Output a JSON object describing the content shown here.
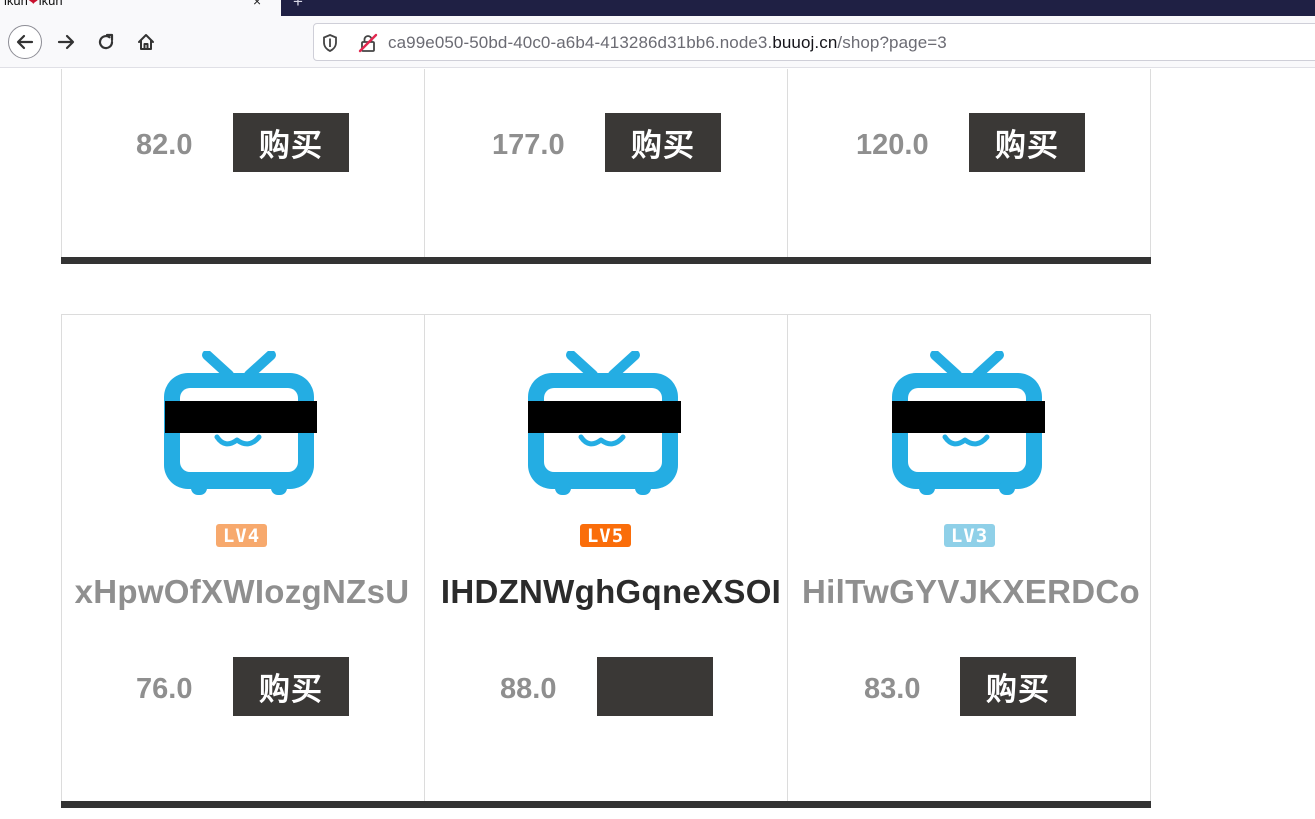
{
  "browser": {
    "tab": {
      "title_prefix": "ikun",
      "heart": "❤",
      "title_suffix": "ikun",
      "close": "×"
    },
    "new_tab": "+",
    "url": {
      "sub": "ca99e050-50bd-40c0-a6b4-413286d31bb6.node3.",
      "domain": "buuoj.cn",
      "path": "/shop?page=3"
    }
  },
  "buy_label": "购买",
  "top_row": [
    {
      "price": "82.0"
    },
    {
      "price": "177.0"
    },
    {
      "price": "120.0"
    }
  ],
  "bottom_row": [
    {
      "name": "xHpwOfXWIozgNZsU",
      "level": "LV4",
      "level_color": "#f7a96d",
      "name_color": "#8f8f8f",
      "price": "76.0",
      "buy_label": "购买"
    },
    {
      "name": "IHDZNWghGqneXSOI",
      "level": "LV5",
      "level_color": "#fa6d0a",
      "name_color": "#2b2b2b",
      "price": "88.0",
      "buy_label": ""
    },
    {
      "name": "HilTwGYVJKXERDCo",
      "level": "LV3",
      "level_color": "#8fd0e8",
      "name_color": "#8f8f8f",
      "price": "83.0",
      "buy_label": "购买"
    }
  ],
  "colors": {
    "tv_blue": "#24ade3",
    "button_bg": "#3a3836",
    "card_bar": "#333333"
  }
}
